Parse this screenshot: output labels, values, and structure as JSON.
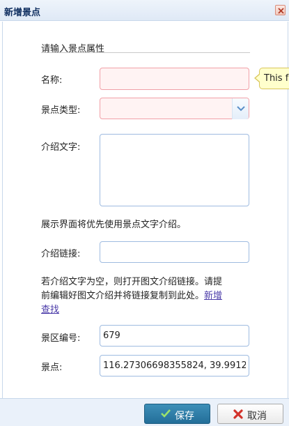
{
  "dialog": {
    "title": "新增景点",
    "close_icon": "close-icon"
  },
  "form": {
    "section_title": "请输入景点属性",
    "name_label": "名称:",
    "name_value": "",
    "type_label": "景点类型:",
    "type_value": "",
    "desc_label": "介绍文字:",
    "desc_value": "",
    "desc_note": "展示界面将优先使用景点文字介绍。",
    "link_label": "介绍链接:",
    "link_value": "",
    "link_note_line1": "若介绍文字为空，则打开图文介绍链接。请提",
    "link_note_line2": "前编辑好图文介绍并将链接复制到此处。",
    "link_note_link_part1": "新增",
    "link_note_link_part2": "查找",
    "area_label": "景区编号:",
    "area_value": "679",
    "point_label": "景点:",
    "point_value": "116.27306698355824, 39.9912"
  },
  "tooltip": {
    "text": "This f"
  },
  "footer": {
    "save_label": "保存",
    "cancel_label": "取消"
  },
  "colors": {
    "accent": "#236e99",
    "invalid_border": "#f1a0a7",
    "invalid_bg": "#fff3f3",
    "tooltip_bg": "#ffffcc"
  }
}
